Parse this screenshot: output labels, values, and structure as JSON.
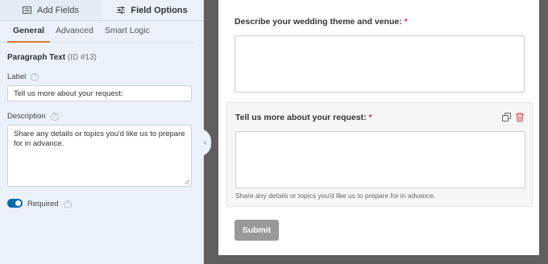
{
  "panel": {
    "top_tabs": [
      {
        "label": "Add Fields",
        "icon": "list-icon"
      },
      {
        "label": "Field Options",
        "icon": "sliders-icon"
      }
    ],
    "sub_tabs": [
      "General",
      "Advanced",
      "Smart Logic"
    ],
    "field_type": "Paragraph Text",
    "field_id": "(ID #13)",
    "label_caption": "Label",
    "label_value": "Tell us more about your request:",
    "description_caption": "Description",
    "description_value": "Share any details or topics you'd like us to prepare for in advance.",
    "required_caption": "Required",
    "required_on": true,
    "help_glyph": "?",
    "collapse_glyph": "‹"
  },
  "preview": {
    "fields": [
      {
        "label": "Describe your wedding theme and venue:",
        "required_mark": "*"
      },
      {
        "label": "Tell us more about your request:",
        "required_mark": "*",
        "description": "Share any details or topics you'd like us to prepare for in advance."
      }
    ],
    "submit_label": "Submit"
  },
  "colors": {
    "accent_orange": "#e27730",
    "toggle_blue": "#056aab",
    "required_red": "#d63638",
    "delete_red": "#d63638"
  }
}
